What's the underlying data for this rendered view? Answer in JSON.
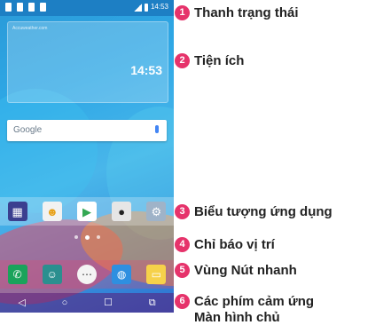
{
  "phone": {
    "widget_source": "Accuweather.com",
    "clock_time": "14:53",
    "status_time": "14:53",
    "search_brand": "Google",
    "app_icons": [
      "app-1",
      "app-2",
      "play-store",
      "camera",
      "settings"
    ],
    "quick_icons": [
      "phone",
      "contacts",
      "apps",
      "browser",
      "memo"
    ],
    "nav_keys": [
      "◁",
      "○",
      "☐",
      "⧉"
    ]
  },
  "callouts": [
    {
      "num": "1",
      "text": "Thanh trạng thái"
    },
    {
      "num": "2",
      "text": "Tiện ích"
    },
    {
      "num": "3",
      "text": "Biểu tượng ứng dụng"
    },
    {
      "num": "4",
      "text": "Chỉ báo vị trí"
    },
    {
      "num": "5",
      "text": "Vùng Nút nhanh"
    },
    {
      "num": "6",
      "text": "Các phím cảm ứng",
      "text2": "Màn hình chủ"
    }
  ],
  "colors": {
    "badge": "#e6336b",
    "statusbar": "#1d7fc4"
  }
}
